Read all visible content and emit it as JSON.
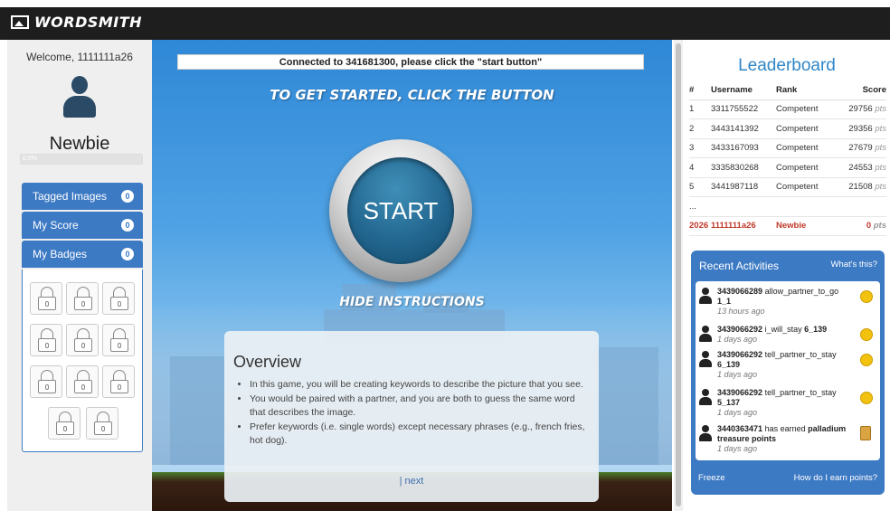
{
  "app": {
    "title": "WORDSMITH"
  },
  "left": {
    "welcome": "Welcome, 1111111a26",
    "rank": "Newbie",
    "progress_label": "0.0%",
    "menu": [
      {
        "label": "Tagged Images",
        "count": "0"
      },
      {
        "label": "My Score",
        "count": "0"
      },
      {
        "label": "My Badges",
        "count": "0"
      }
    ]
  },
  "game": {
    "connection": "Connected to 341681300, please click the \"start button\"",
    "headline": "TO GET STARTED, CLICK THE BUTTON",
    "start": "START",
    "hide": "HIDE INSTRUCTIONS",
    "overview": {
      "title": "Overview",
      "bullets": [
        "In this game, you will be creating keywords to describe the picture that you see.",
        "You would be paired with a partner, and you are both to guess the same word that describes the image.",
        "Prefer keywords (i.e. single words) except necessary phrases (e.g., french fries, hot dog)."
      ],
      "next": "| next"
    }
  },
  "leaderboard": {
    "title": "Leaderboard",
    "headers": [
      "#",
      "Username",
      "Rank",
      "Score"
    ],
    "rows": [
      {
        "n": "1",
        "user": "3311755522",
        "rank": "Competent",
        "score": "29756",
        "unit": "pts"
      },
      {
        "n": "2",
        "user": "3443141392",
        "rank": "Competent",
        "score": "29356",
        "unit": "pts"
      },
      {
        "n": "3",
        "user": "3433167093",
        "rank": "Competent",
        "score": "27679",
        "unit": "pts"
      },
      {
        "n": "4",
        "user": "3335830268",
        "rank": "Competent",
        "score": "24553",
        "unit": "pts"
      },
      {
        "n": "5",
        "user": "3441987118",
        "rank": "Competent",
        "score": "21508",
        "unit": "pts"
      }
    ],
    "ellipsis": "...",
    "me": {
      "n": "2026",
      "user": "1111111a26",
      "rank": "Newbie",
      "score": "0",
      "unit": "pts"
    }
  },
  "recent": {
    "title": "Recent Activities",
    "whats_this": "What's this?",
    "items": [
      {
        "user": "3439066289",
        "action": "allow_partner_to_go",
        "bold": "1_1",
        "ago": "13 hours ago",
        "icon": "coin-icon"
      },
      {
        "user": "3439066292",
        "action": "i_will_stay",
        "bold": "6_139",
        "ago": "1 days ago",
        "icon": "coin-icon"
      },
      {
        "user": "3439066292",
        "action": "tell_partner_to_stay",
        "bold": "6_139",
        "ago": "1 days ago",
        "icon": "coin-icon"
      },
      {
        "user": "3439066292",
        "action": "tell_partner_to_stay",
        "bold": "5_137",
        "ago": "1 days ago",
        "icon": "coin-icon"
      },
      {
        "user": "3440363471",
        "action": "has earned",
        "bold": "palladium treasure points",
        "ago": "1 days ago",
        "icon": "treasure-icon"
      }
    ],
    "freeze": "Freeze",
    "how": "How do I earn points?"
  }
}
